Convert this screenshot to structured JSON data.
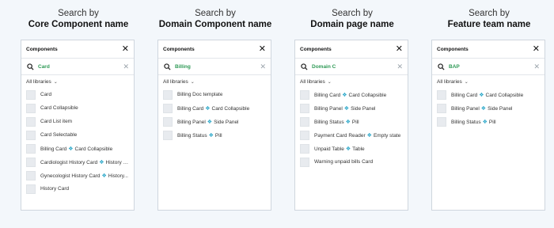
{
  "columns": [
    {
      "heading_line1": "Search by",
      "heading_line2": "Core Component name",
      "panel_title": "Components",
      "search_value": "Card",
      "filter_label": "All libraries",
      "items": [
        {
          "name": "Card"
        },
        {
          "name": "Card Collapsible"
        },
        {
          "name": "Card List item"
        },
        {
          "name": "Card Selectable"
        },
        {
          "name": "Billing Card",
          "related": "Card Collapsible"
        },
        {
          "name": "Cardiologist History Card",
          "related": "History c..."
        },
        {
          "name": "Gynecologist History Card",
          "related": "History..."
        },
        {
          "name": "History Card"
        }
      ]
    },
    {
      "heading_line1": "Search by",
      "heading_line2": "Domain Component name",
      "panel_title": "Components",
      "search_value": "Billing",
      "filter_label": "All libraries",
      "items": [
        {
          "name": "Billing Doc template"
        },
        {
          "name": "Billing Card",
          "related": "Card Collapsible"
        },
        {
          "name": "Billing Panel",
          "related": "Side Panel"
        },
        {
          "name": "Billing Status",
          "related": "Pill"
        }
      ]
    },
    {
      "heading_line1": "Search by",
      "heading_line2": "Domain page name",
      "panel_title": "Components",
      "search_value": "Domain C",
      "filter_label": "All libraries",
      "items": [
        {
          "name": "Billing Card",
          "related": "Card Collapsible"
        },
        {
          "name": "Billing Panel",
          "related": "Side Panel"
        },
        {
          "name": "Billing Status",
          "related": "Pill"
        },
        {
          "name": "Payment Card Reader",
          "related": "Empty state"
        },
        {
          "name": "Unpaid Table",
          "related": "Table"
        },
        {
          "name": "Warning unpaid bills Card"
        }
      ]
    },
    {
      "heading_line1": "Search by",
      "heading_line2": "Feature team name",
      "panel_title": "Components",
      "search_value": "BAP",
      "filter_label": "All libraries",
      "items": [
        {
          "name": "Billing Card",
          "related": "Card Collapsible"
        },
        {
          "name": "Billing Panel",
          "related": "Side Panel"
        },
        {
          "name": "Billing Status",
          "related": "Pill"
        }
      ]
    }
  ],
  "colors": {
    "search_text": "#2f9a56",
    "link_icon": "#2aa7c9",
    "background": "#f3f7fb"
  },
  "icons": {
    "close": "close-icon",
    "search": "search-icon",
    "clear": "clear-icon",
    "chevron": "chevron-down-icon",
    "link": "link-icon"
  }
}
